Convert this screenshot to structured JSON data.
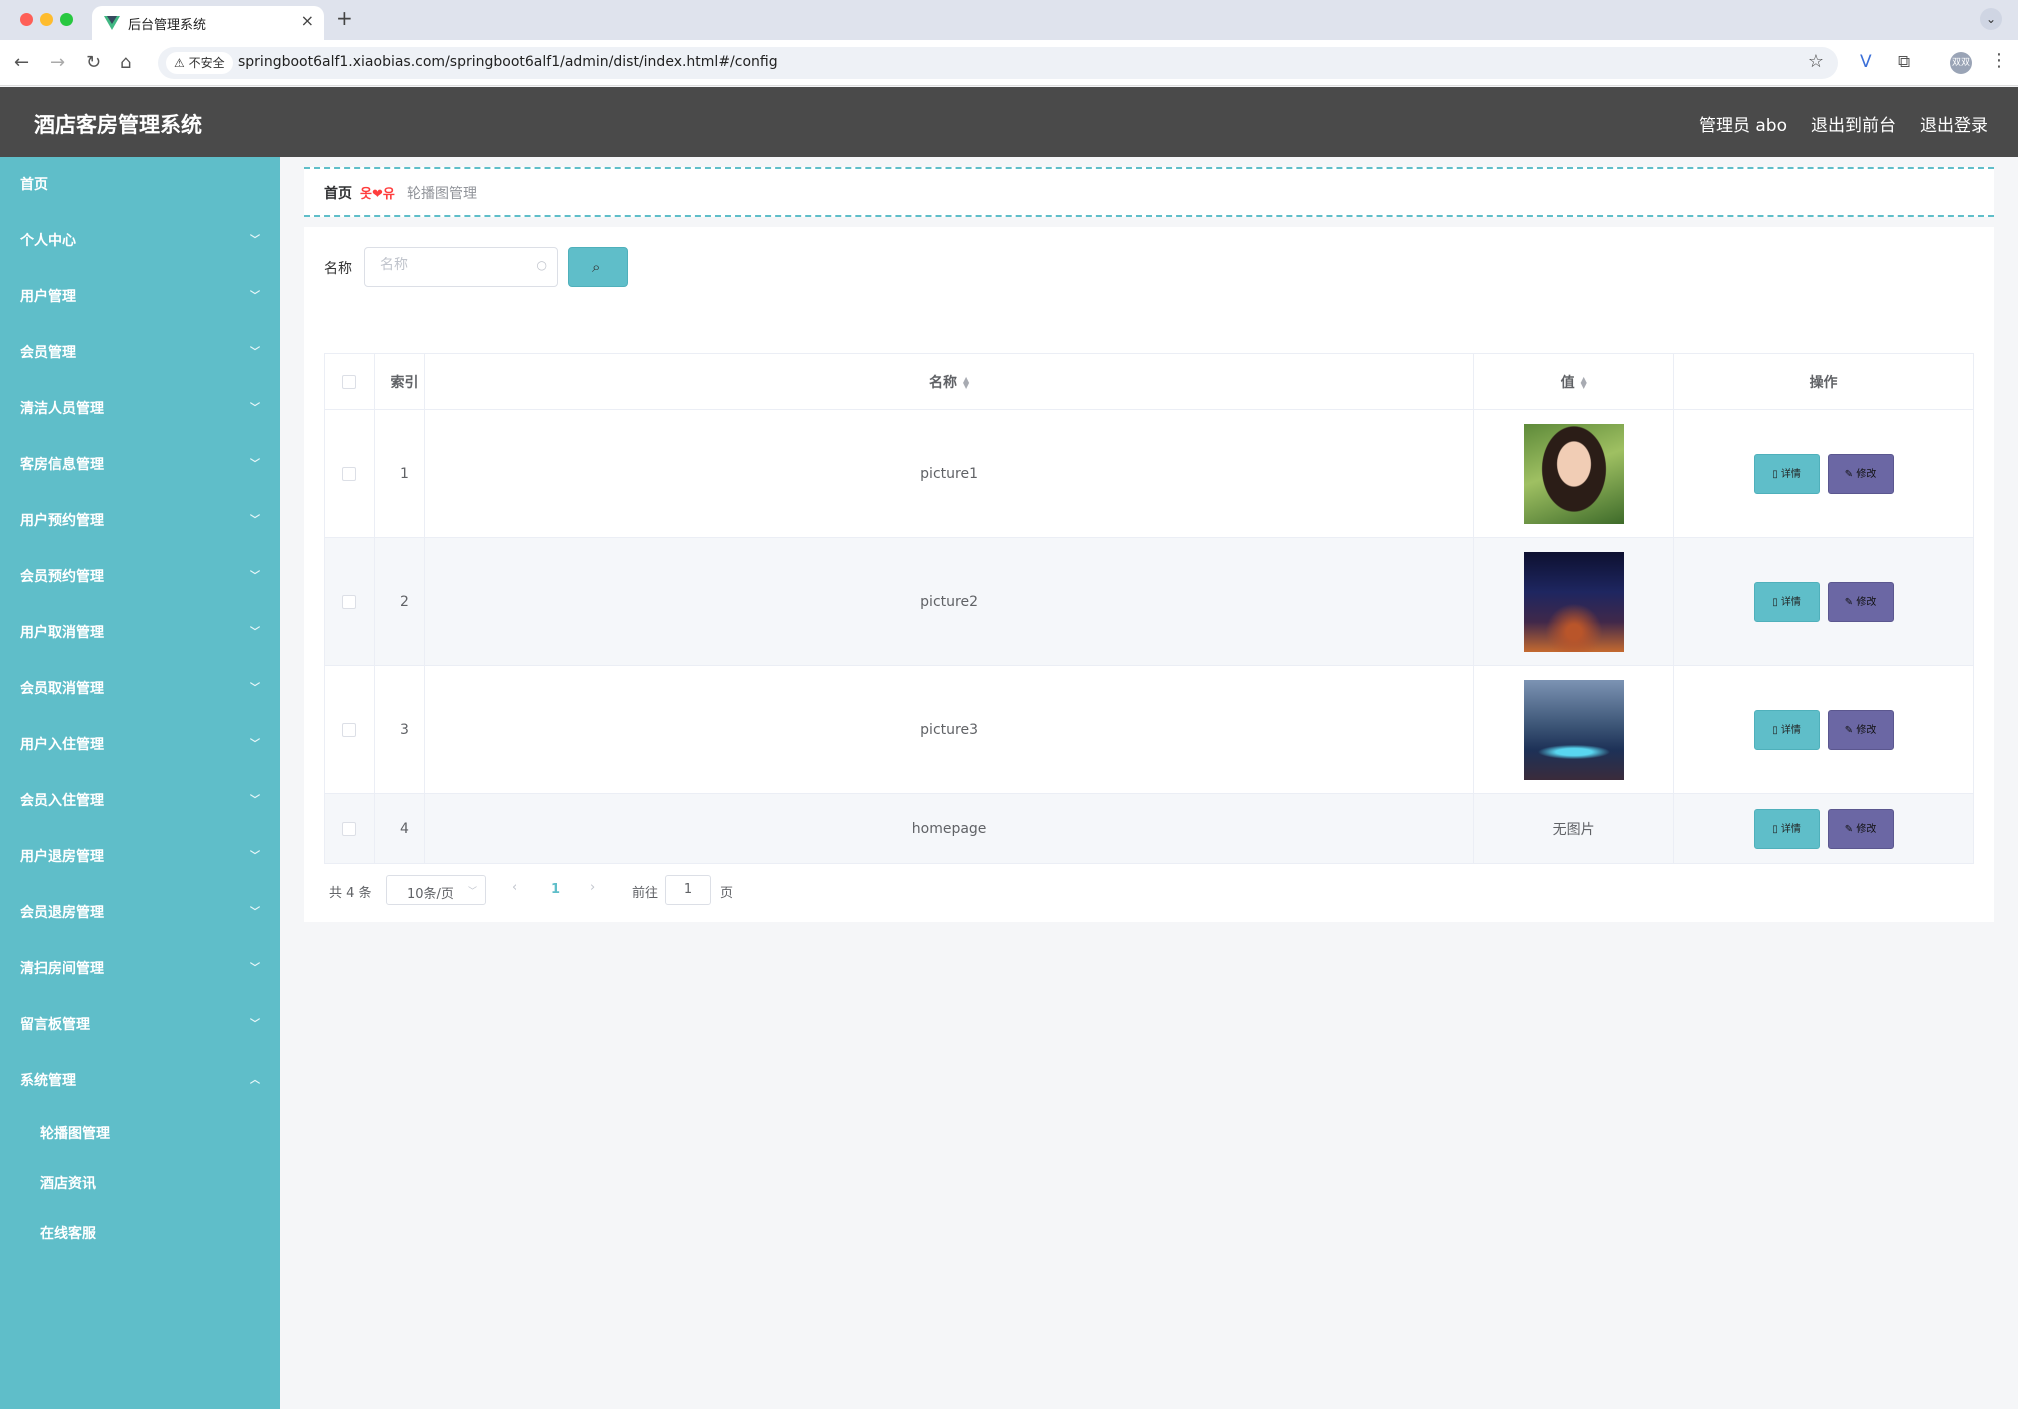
{
  "browser": {
    "tab_title": "后台管理系统",
    "insecure_label": "不安全",
    "url": "springboot6alf1.xiaobias.com/springboot6alf1/admin/dist/index.html#/config",
    "profile": "双双"
  },
  "header": {
    "title": "酒店客房管理系统",
    "user": "管理员 abo",
    "front_link": "退出到前台",
    "logout": "退出登录"
  },
  "sidebar": {
    "items": [
      {
        "label": "首页"
      },
      {
        "label": "个人中心"
      },
      {
        "label": "用户管理"
      },
      {
        "label": "会员管理"
      },
      {
        "label": "清洁人员管理"
      },
      {
        "label": "客房信息管理"
      },
      {
        "label": "用户预约管理"
      },
      {
        "label": "会员预约管理"
      },
      {
        "label": "用户取消管理"
      },
      {
        "label": "会员取消管理"
      },
      {
        "label": "用户入住管理"
      },
      {
        "label": "会员入住管理"
      },
      {
        "label": "用户退房管理"
      },
      {
        "label": "会员退房管理"
      },
      {
        "label": "清扫房间管理"
      },
      {
        "label": "留言板管理"
      },
      {
        "label": "系统管理"
      }
    ],
    "sub_items": [
      {
        "label": "轮播图管理"
      },
      {
        "label": "酒店资讯"
      },
      {
        "label": "在线客服"
      }
    ]
  },
  "breadcrumb": {
    "home": "首页",
    "separator": "옷❤유",
    "current": "轮播图管理"
  },
  "search": {
    "label": "名称",
    "placeholder": "名称"
  },
  "table": {
    "headers": {
      "index": "索引",
      "name": "名称",
      "value": "值",
      "actions": "操作"
    },
    "rows": [
      {
        "index": "1",
        "name": "picture1",
        "value": ""
      },
      {
        "index": "2",
        "name": "picture2",
        "value": ""
      },
      {
        "index": "3",
        "name": "picture3",
        "value": ""
      },
      {
        "index": "4",
        "name": "homepage",
        "value": "无图片"
      }
    ],
    "detail_label": "详情",
    "edit_label": "修改"
  },
  "pagination": {
    "total": "共 4 条",
    "page_size": "10条/页",
    "current_page": "1",
    "goto_label": "前往",
    "goto_value": "1",
    "page_unit": "页"
  },
  "colors": {
    "sidebar": "#5fbec9",
    "header": "#4a4a4a",
    "edit_button": "#6b67a4"
  }
}
